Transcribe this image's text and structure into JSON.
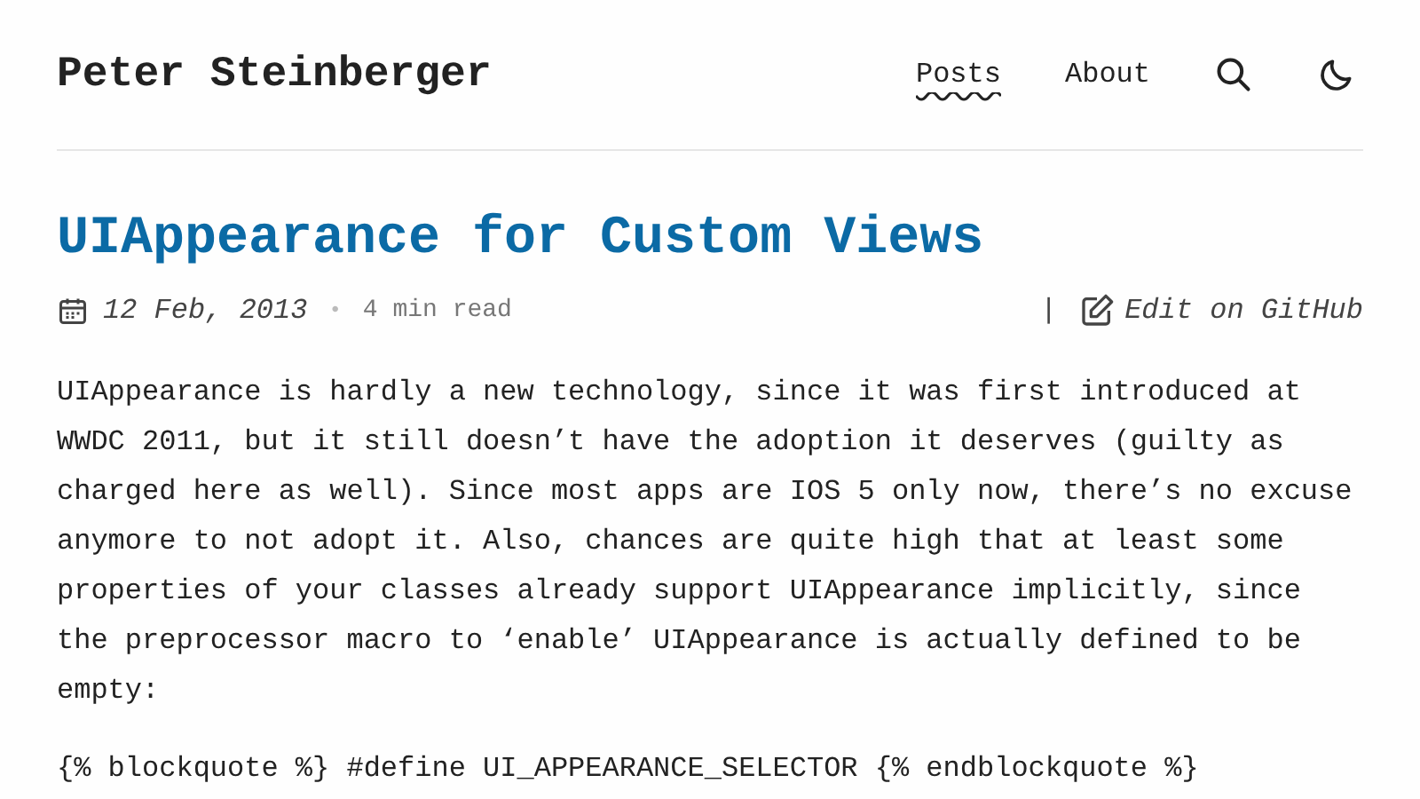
{
  "site_title": "Peter Steinberger",
  "nav": [
    {
      "label": "Posts",
      "selected": true
    },
    {
      "label": "About",
      "selected": false
    }
  ],
  "post": {
    "title": "UIAppearance for Custom Views",
    "date": "12 Feb, 2013",
    "separator": "•",
    "read_time": "4 min read",
    "divider": "|",
    "edit_link": "Edit on GitHub",
    "paragraphs": [
      "UIAppearance is hardly a new technology, since it was first introduced at WWDC 2011, but it still doesn’t have the adoption it deserves (guilty as charged here as well). Since most apps are IOS 5 only now, there’s no excuse anymore to not adopt it. Also, chances are quite high that at least some properties of your classes already support UIAppearance implicitly, since the preprocessor macro to ‘enable’ UIAppearance is actually defined to be empty:",
      "{% blockquote %} #define UI_APPEARANCE_SELECTOR {% endblockquote %}"
    ]
  }
}
